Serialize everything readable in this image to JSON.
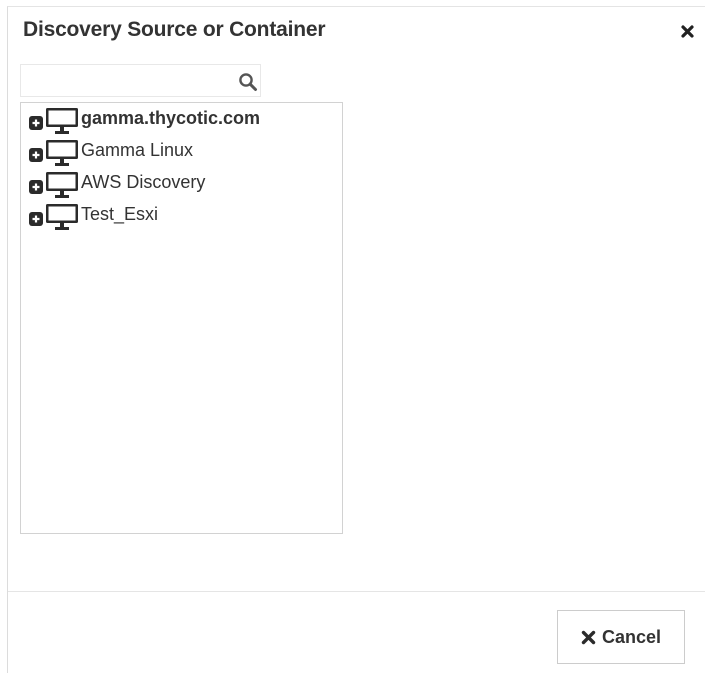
{
  "dialog": {
    "title": "Discovery Source or Container",
    "close_icon": "close-icon"
  },
  "search": {
    "value": "",
    "placeholder": "",
    "icon": "search-icon"
  },
  "tree": {
    "items": [
      {
        "label": "gamma.thycotic.com",
        "selected": true,
        "icon": "computer-icon",
        "expander": "expand-plus-icon"
      },
      {
        "label": "Gamma Linux",
        "selected": false,
        "icon": "computer-icon",
        "expander": "expand-plus-icon"
      },
      {
        "label": "AWS Discovery",
        "selected": false,
        "icon": "computer-icon",
        "expander": "expand-plus-icon"
      },
      {
        "label": "Test_Esxi",
        "selected": false,
        "icon": "computer-icon",
        "expander": "expand-plus-icon"
      }
    ]
  },
  "footer": {
    "cancel_label": "Cancel",
    "cancel_icon": "close-icon"
  },
  "colors": {
    "text": "#333333",
    "border": "#cccccc",
    "icon": "#2b2b2b"
  }
}
